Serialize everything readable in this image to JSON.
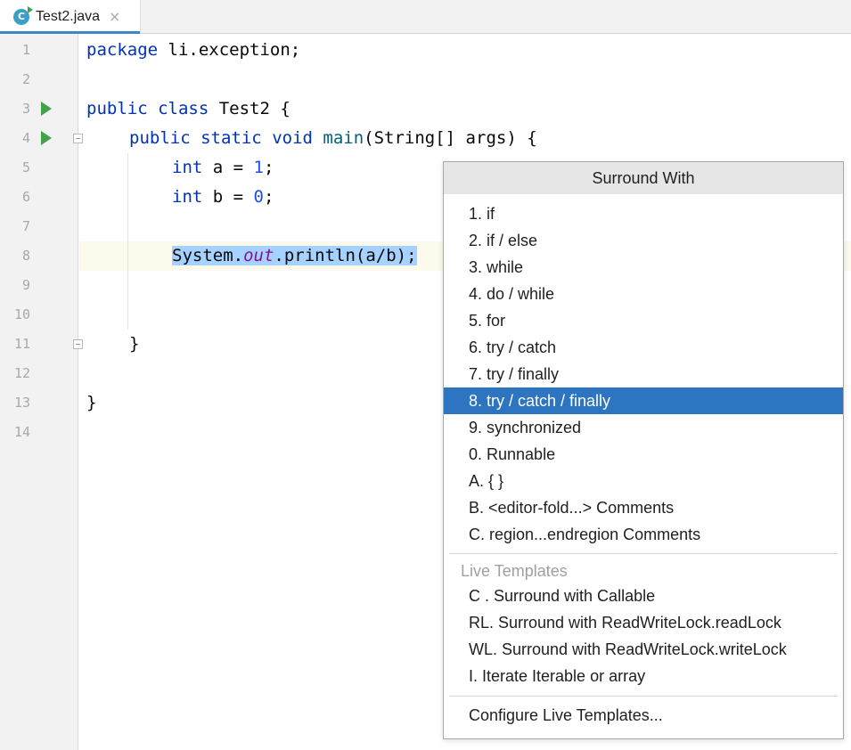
{
  "tab": {
    "title": "Test2.java",
    "icon_letter": "C",
    "close_glyph": "×"
  },
  "gutter": {
    "line_numbers": [
      "1",
      "2",
      "3",
      "4",
      "5",
      "6",
      "7",
      "8",
      "9",
      "10",
      "11",
      "12",
      "13",
      "14"
    ]
  },
  "code": {
    "line1": {
      "kw": "package",
      "rest": " li.exception;"
    },
    "line3": {
      "kw1": "public",
      "kw2": "class",
      "rest": " Test2 {"
    },
    "line4": {
      "kw1": "public",
      "kw2": "static",
      "kw3": "void",
      "fn": "main",
      "rest": "(String[] args) {"
    },
    "line5": {
      "kw": "int",
      "mid": " a = ",
      "num": "1",
      "end": ";"
    },
    "line6": {
      "kw": "int",
      "mid": " b = ",
      "num": "0",
      "end": ";"
    },
    "line8": {
      "pre": "System.",
      "field": "out",
      "post": ".println(a/b);"
    },
    "line11": {
      "text": "}"
    },
    "line13": {
      "text": "}"
    }
  },
  "popup": {
    "title": "Surround With",
    "items": [
      "1. if",
      "2. if / else",
      "3. while",
      "4. do / while",
      "5. for",
      "6. try / catch",
      "7. try / finally",
      "8. try / catch / finally",
      "9. synchronized",
      "0. Runnable",
      "A. { }",
      "B. <editor-fold...> Comments",
      "C. region...endregion Comments"
    ],
    "selected_index": 7,
    "live_templates_header": "Live Templates",
    "live_templates": [
      "C . Surround with Callable",
      "RL. Surround with ReadWriteLock.readLock",
      "WL. Surround with ReadWriteLock.writeLock",
      "I. Iterate Iterable or array"
    ],
    "configure": "Configure Live Templates..."
  },
  "colors": {
    "keyword": "#0033b3",
    "number": "#1750eb",
    "static_field": "#871094",
    "selection": "#a6d2ff",
    "popup_selected": "#2e75c1",
    "run_icon": "#45a04d"
  }
}
